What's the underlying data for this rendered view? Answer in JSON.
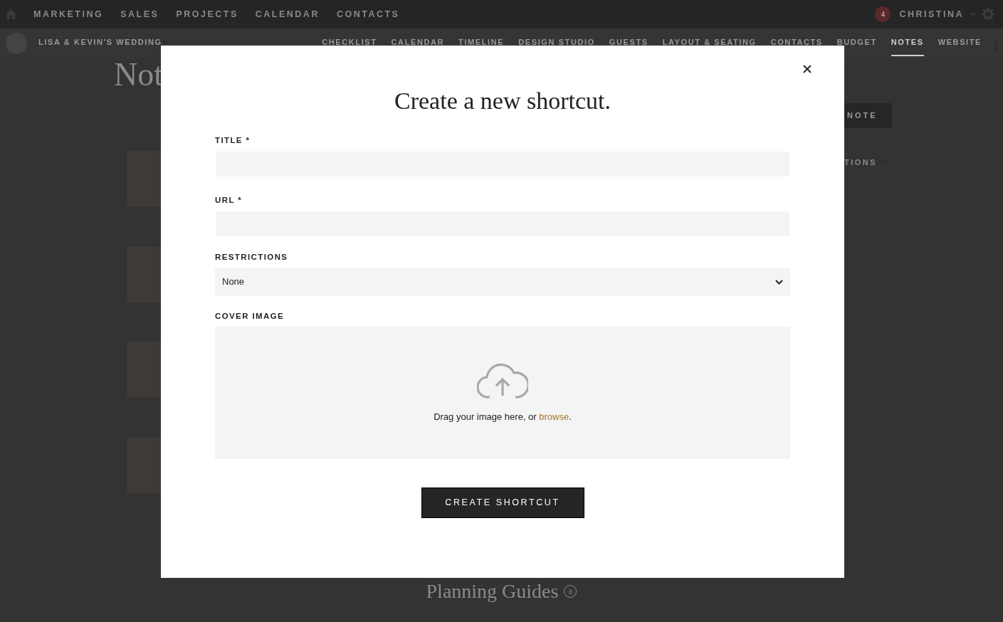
{
  "top_nav": {
    "items": [
      "MARKETING",
      "SALES",
      "PROJECTS",
      "CALENDAR",
      "CONTACTS"
    ],
    "user": {
      "badge": "4",
      "name": "CHRISTINA"
    }
  },
  "project_nav": {
    "project": "LISA & KEVIN'S WEDDING",
    "tabs": [
      {
        "label": "CHECKLIST",
        "selected": false
      },
      {
        "label": "CALENDAR",
        "selected": false
      },
      {
        "label": "TIMELINE",
        "selected": false
      },
      {
        "label": "DESIGN STUDIO",
        "selected": false
      },
      {
        "label": "GUESTS",
        "selected": false
      },
      {
        "label": "LAYOUT & SEATING",
        "selected": false
      },
      {
        "label": "CONTACTS",
        "selected": false
      },
      {
        "label": "BUDGET",
        "selected": false
      },
      {
        "label": "NOTES",
        "selected": true
      },
      {
        "label": "WEBSITE",
        "selected": false
      }
    ]
  },
  "page": {
    "title": "Not",
    "action_button": "NOTE",
    "filter": "TIONS",
    "section_title": "Planning Guides",
    "section_count": "8"
  },
  "modal": {
    "title": "Create a new shortcut.",
    "fields": [
      {
        "kind": "text",
        "label": "TITLE *"
      },
      {
        "kind": "text",
        "label": "URL *"
      },
      {
        "kind": "select",
        "label": "RESTRICTIONS",
        "value": "None"
      },
      {
        "kind": "upload",
        "label": "COVER IMAGE",
        "prompt": "Drag your image here, or ",
        "link": "browse",
        "prompt_end": "."
      }
    ],
    "submit": "CREATE SHORTCUT"
  }
}
